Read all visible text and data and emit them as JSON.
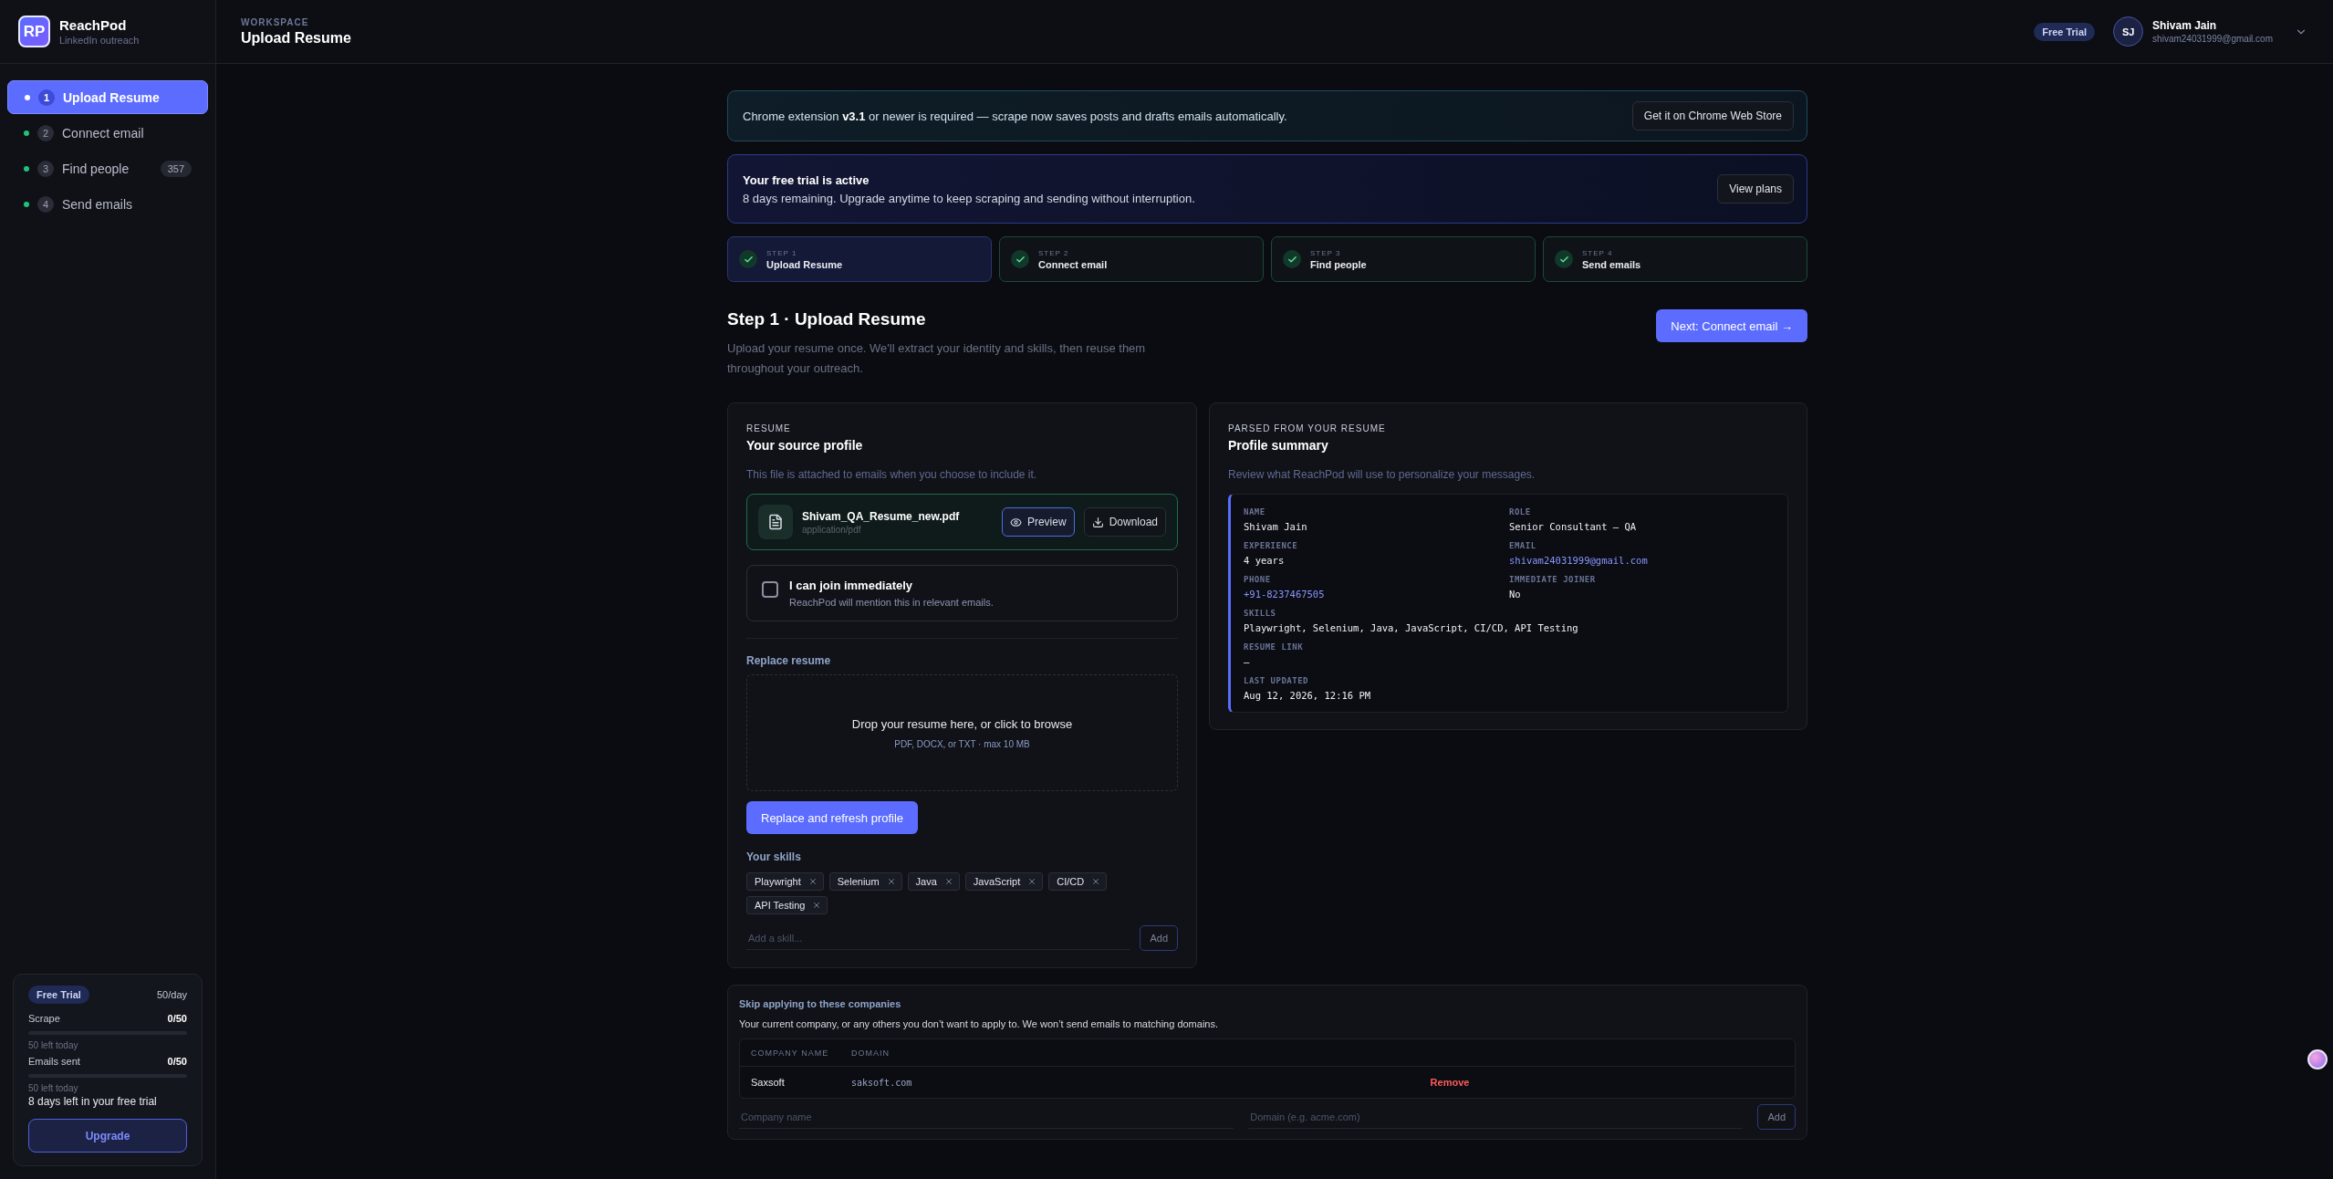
{
  "brand": {
    "logo": "RP",
    "name": "ReachPod",
    "tagline": "LinkedIn outreach"
  },
  "nav": [
    {
      "number": "1",
      "label": "Upload Resume",
      "selected": true
    },
    {
      "number": "2",
      "label": "Connect email",
      "selected": false
    },
    {
      "number": "3",
      "label": "Find people",
      "selected": false,
      "badge": "357"
    },
    {
      "number": "4",
      "label": "Send emails",
      "selected": false
    }
  ],
  "plan": {
    "badge": "Free Trial",
    "rate": "50/day",
    "meters": [
      {
        "label": "Scrape",
        "value": "0/50",
        "level": 0,
        "note": "50 left today"
      },
      {
        "label": "Emails sent",
        "value": "0/50",
        "level": 0,
        "note": "50 left today"
      }
    ],
    "days_left": "8 days left in your free trial",
    "button": "Upgrade"
  },
  "header": {
    "eyebrow": "WORKSPACE",
    "title": "Upload Resume",
    "plan_badge": "Free Trial",
    "user": {
      "initials": "SJ",
      "name": "Shivam Jain",
      "email": "shivam24031999@gmail.com"
    }
  },
  "extension_banner": {
    "text": "Chrome extension **v3.1** or newer is required — scrape now saves posts and drafts emails automatically.",
    "button": "Get it on Chrome Web Store"
  },
  "trial_banner": {
    "title": "Your free trial is active",
    "text": "8 days remaining. Upgrade anytime to keep scraping and sending without interruption.",
    "button": "View plans"
  },
  "steps": [
    {
      "step": "STEP 1",
      "label": "Upload Resume",
      "selected": true,
      "done": true
    },
    {
      "step": "STEP 2",
      "label": "Connect email",
      "selected": false,
      "done": true
    },
    {
      "step": "STEP 3",
      "label": "Find people",
      "selected": false,
      "done": true
    },
    {
      "step": "STEP 4",
      "label": "Send emails",
      "selected": false,
      "done": true
    }
  ],
  "page": {
    "title": "Step 1 · Upload Resume",
    "subtitle": "Upload your resume once. We'll extract your identity and skills, then reuse them throughout your outreach.",
    "next_button": "Next: Connect email →"
  },
  "resume_card": {
    "eyebrow": "RESUME",
    "title": "Your source profile",
    "description": "This file is attached to emails when you choose to include it.",
    "file": {
      "name": "Shivam_QA_Resume_new.pdf",
      "type": "application/pdf",
      "preview": "Preview",
      "download": "Download"
    },
    "join": {
      "label": "I can join immediately",
      "hint": "ReachPod will mention this in relevant emails.",
      "checked": false
    },
    "replace_label": "Replace resume",
    "drop_title": "Drop your resume here, or click to browse",
    "drop_hint": "PDF, DOCX, or TXT · max 10 MB",
    "replace_button": "Replace and refresh profile",
    "skills_label": "Your skills",
    "skills": [
      "Playwright",
      "Selenium",
      "Java",
      "JavaScript",
      "CI/CD",
      "API Testing"
    ],
    "skill_placeholder": "Add a skill...",
    "add_button": "Add"
  },
  "summary_card": {
    "eyebrow": "PARSED FROM YOUR RESUME",
    "title": "Profile summary",
    "description": "Review what ReachPod will use to personalize your messages.",
    "fields": [
      {
        "label": "NAME",
        "value": "Shivam Jain",
        "kind": "text"
      },
      {
        "label": "ROLE",
        "value": "Senior Consultant – QA",
        "kind": "text"
      },
      {
        "label": "EXPERIENCE",
        "value": "4 years",
        "kind": "text"
      },
      {
        "label": "EMAIL",
        "value": "shivam24031999@gmail.com",
        "kind": "link"
      },
      {
        "label": "PHONE",
        "value": "+91-8237467505",
        "kind": "link"
      },
      {
        "label": "IMMEDIATE JOINER",
        "value": "No",
        "kind": "text"
      }
    ],
    "details": [
      {
        "label": "SKILLS",
        "value": "Playwright, Selenium, Java, JavaScript, CI/CD, API Testing"
      },
      {
        "label": "RESUME LINK",
        "value": "–"
      },
      {
        "label": "LAST UPDATED",
        "value": "Aug 12, 2026, 12:16 PM"
      }
    ]
  },
  "exclusions": {
    "title": "Skip applying to these companies",
    "description": "Your current company, or any others you don’t want to apply to. We won’t send emails to matching domains.",
    "columns": [
      "COMPANY NAME",
      "DOMAIN"
    ],
    "rows": [
      {
        "company": "Saxsoft",
        "domain": "saksoft.com",
        "action": "Remove"
      }
    ],
    "company_placeholder": "Company name",
    "domain_placeholder": "Domain (e.g. acme.com)",
    "add_button": "Add"
  }
}
